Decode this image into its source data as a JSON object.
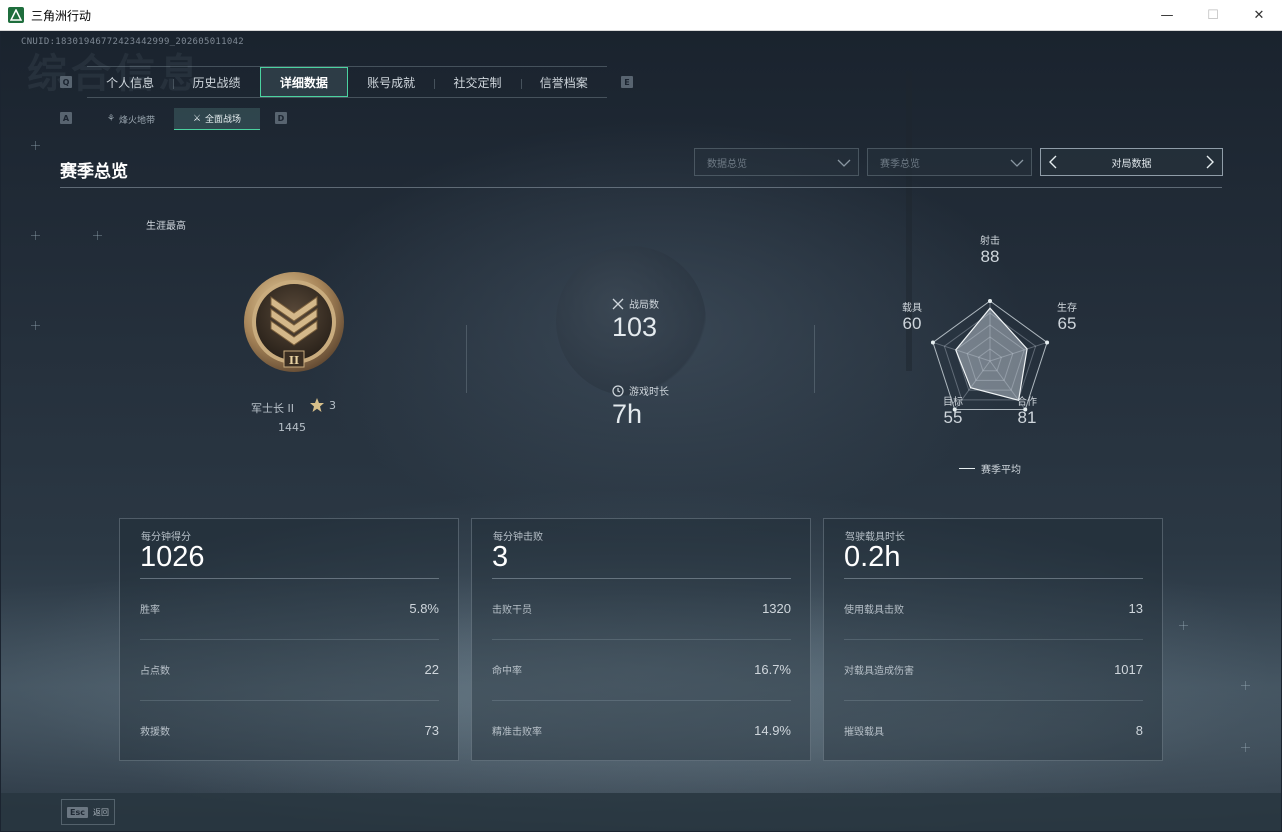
{
  "window": {
    "title": "三角洲行动",
    "minimize_icon": "—",
    "maximize_icon": "☐",
    "close_icon": "✕"
  },
  "cnuid": "CNUID:18301946772423442999_202605011042",
  "ghost_title": "综合信息",
  "main_tabs": [
    {
      "label": "个人信息",
      "active": false
    },
    {
      "label": "历史战绩",
      "active": false
    },
    {
      "label": "详细数据",
      "active": true
    },
    {
      "label": "账号成就",
      "active": false
    },
    {
      "label": "社交定制",
      "active": false
    },
    {
      "label": "信誉档案",
      "active": false
    }
  ],
  "key_hints": {
    "q": "Q",
    "e": "E",
    "a": "A",
    "d": "D"
  },
  "sub_tabs": [
    {
      "label": "烽火地带",
      "active": false
    },
    {
      "label": "全面战场",
      "active": true
    }
  ],
  "section_title": "赛季总览",
  "filters": {
    "data_overview": "数据总览",
    "season_overview": "赛季总览",
    "pager_label": "对局数据"
  },
  "career": {
    "label": "生涯最高",
    "rank_name": "军士长 II",
    "rank_numeral": "II",
    "stars": "3",
    "score": "1445"
  },
  "overview": {
    "matches_label": "战局数",
    "matches_value": "103",
    "playtime_label": "游戏时长",
    "playtime_value": "7h"
  },
  "radar": {
    "axes": [
      {
        "name": "射击",
        "value": "88"
      },
      {
        "name": "生存",
        "value": "65"
      },
      {
        "name": "合作",
        "value": "81"
      },
      {
        "name": "目标",
        "value": "55"
      },
      {
        "name": "载具",
        "value": "60"
      }
    ],
    "values": [
      88,
      65,
      81,
      55,
      60
    ],
    "max": 100,
    "legend": "赛季平均"
  },
  "cards": [
    {
      "head_label": "每分钟得分",
      "head_value": "1026",
      "rows": [
        {
          "label": "胜率",
          "value": "5.8%"
        },
        {
          "label": "占点数",
          "value": "22"
        },
        {
          "label": "救援数",
          "value": "73"
        }
      ]
    },
    {
      "head_label": "每分钟击败",
      "head_value": "3",
      "rows": [
        {
          "label": "击败干员",
          "value": "1320"
        },
        {
          "label": "命中率",
          "value": "16.7%"
        },
        {
          "label": "精准击败率",
          "value": "14.9%"
        }
      ]
    },
    {
      "head_label": "驾驶载具时长",
      "head_value": "0.2h",
      "rows": [
        {
          "label": "使用载具击败",
          "value": "13"
        },
        {
          "label": "对载具造成伤害",
          "value": "1017"
        },
        {
          "label": "摧毁载具",
          "value": "8"
        }
      ]
    }
  ],
  "footer": {
    "esc_key": "Esc",
    "back_label": "返回"
  },
  "colors": {
    "accent": "#4bd2a0",
    "background": "#1b2430"
  }
}
